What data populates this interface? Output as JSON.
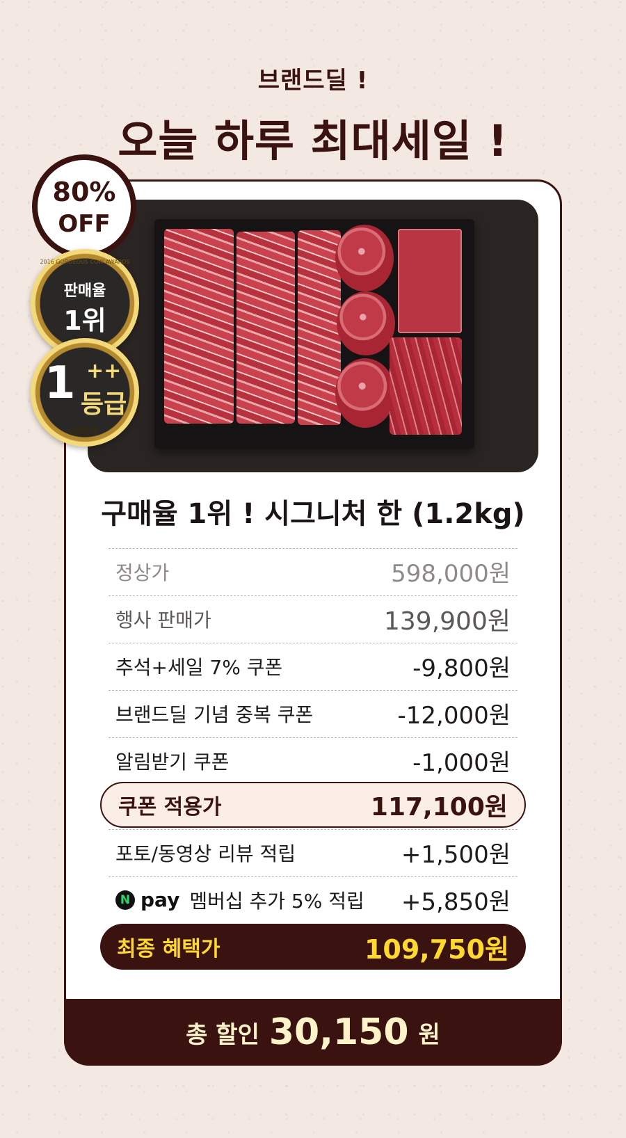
{
  "header": {
    "subtitle": "브랜드딜 !",
    "title": "오늘 하루 최대세일 !"
  },
  "badges": {
    "discount_pct": "80%",
    "discount_off": "OFF",
    "rank_line1": "판매율",
    "rank_line2": "1위",
    "rank_ring_text": "2016 GORGEOUS COW AWARDS",
    "grade_number": "1",
    "grade_plus": "++",
    "grade_word": "등급",
    "grade_brand": "화려한우"
  },
  "product": {
    "name": "구매율 1위 ! 시그니처 한 (1.2kg)"
  },
  "price_rows": [
    {
      "label": "정상가",
      "value": "598,000원"
    },
    {
      "label": "행사 판매가",
      "value": "139,900원"
    },
    {
      "label": "추석+세일 7% 쿠폰",
      "value": "-9,800원"
    },
    {
      "label": "브랜드딜 기념 중복 쿠폰",
      "value": "-12,000원"
    },
    {
      "label": "알림받기 쿠폰",
      "value": "-1,000원"
    }
  ],
  "coupon_applied": {
    "label": "쿠폰 적용가",
    "value": "117,100원"
  },
  "reward_rows": [
    {
      "label": "포토/동영상 리뷰 적립",
      "value": "+1,500원"
    },
    {
      "npay_letter": "N",
      "npay_word": "pay",
      "label": "멤버십 추가 5% 적립",
      "value": "+5,850원"
    }
  ],
  "final": {
    "label": "최종 혜택가",
    "value": "109,750원"
  },
  "total": {
    "label": "총 할인",
    "amount": "30,150",
    "unit": "원"
  },
  "colors": {
    "brand": "#3a1210",
    "accent": "#ffd92e",
    "background": "#f3e9e2"
  }
}
